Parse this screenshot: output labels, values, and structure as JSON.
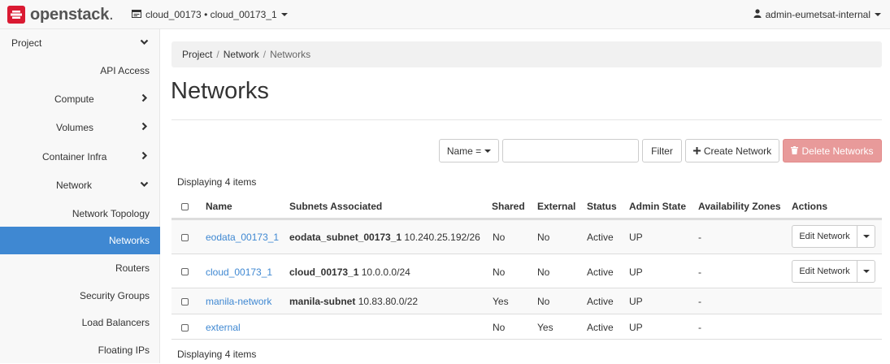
{
  "brand": {
    "name": "openstack",
    "dot": "."
  },
  "header": {
    "project_switch": "cloud_00173 • cloud_00173_1",
    "user": "admin-eumetsat-internal"
  },
  "sidebar": {
    "items": [
      {
        "label": "Project"
      },
      {
        "label": "API Access"
      },
      {
        "label": "Compute"
      },
      {
        "label": "Volumes"
      },
      {
        "label": "Container Infra"
      },
      {
        "label": "Network"
      },
      {
        "label": "Network Topology"
      },
      {
        "label": "Networks"
      },
      {
        "label": "Routers"
      },
      {
        "label": "Security Groups"
      },
      {
        "label": "Load Balancers"
      },
      {
        "label": "Floating IPs"
      }
    ]
  },
  "breadcrumb": {
    "items": [
      "Project",
      "Network",
      "Networks"
    ],
    "sep": "/"
  },
  "page": {
    "title": "Networks"
  },
  "toolbar": {
    "filter_field": "Name =",
    "search_value": "",
    "filter_label": "Filter",
    "create_label": "Create Network",
    "delete_label": "Delete Networks"
  },
  "table": {
    "count_top": "Displaying 4 items",
    "count_bottom": "Displaying 4 items",
    "headers": {
      "name": "Name",
      "subnets": "Subnets Associated",
      "shared": "Shared",
      "external": "External",
      "status": "Status",
      "admin": "Admin State",
      "az": "Availability Zones",
      "actions": "Actions"
    },
    "rows": [
      {
        "name": "eodata_00173_1",
        "subnet_name": "eodata_subnet_00173_1",
        "subnet_cidr": "10.240.25.192/26",
        "shared": "No",
        "external": "No",
        "status": "Active",
        "admin": "UP",
        "az": "-",
        "action": "Edit Network"
      },
      {
        "name": "cloud_00173_1",
        "subnet_name": "cloud_00173_1",
        "subnet_cidr": "10.0.0.0/24",
        "shared": "No",
        "external": "No",
        "status": "Active",
        "admin": "UP",
        "az": "-",
        "action": "Edit Network"
      },
      {
        "name": "manila-network",
        "subnet_name": "manila-subnet",
        "subnet_cidr": "10.83.80.0/22",
        "shared": "Yes",
        "external": "No",
        "status": "Active",
        "admin": "UP",
        "az": "-",
        "action": ""
      },
      {
        "name": "external",
        "subnet_name": "",
        "subnet_cidr": "",
        "shared": "No",
        "external": "Yes",
        "status": "Active",
        "admin": "UP",
        "az": "-",
        "action": ""
      }
    ]
  },
  "colors": {
    "accent": "#3f88d2",
    "danger": "#e89a9a",
    "brand_red": "#da1a32"
  }
}
